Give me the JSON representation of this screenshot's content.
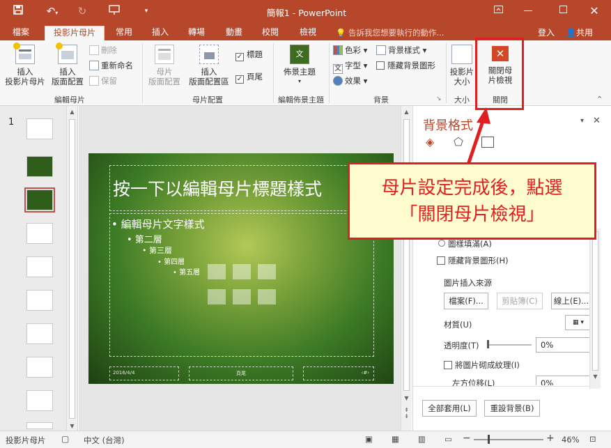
{
  "window": {
    "title": "簡報1 - PowerPoint",
    "controls": [
      "ribbon-display-icon",
      "minimize-icon",
      "restore-icon",
      "close-icon"
    ]
  },
  "quick_access": [
    "save-icon",
    "undo-icon",
    "redo-icon",
    "present-icon",
    "customize-icon"
  ],
  "tabs": [
    {
      "label": "檔案"
    },
    {
      "label": "投影片母片",
      "active": true
    },
    {
      "label": "常用"
    },
    {
      "label": "插入"
    },
    {
      "label": "轉場"
    },
    {
      "label": "動畫"
    },
    {
      "label": "校閱"
    },
    {
      "label": "檢視"
    }
  ],
  "tell_me": "告訴我您想要執行的動作...",
  "signin": "登入",
  "share": "共用",
  "ribbon": {
    "edit_master": {
      "label": "編輯母片",
      "insert_slide_master": "插入\n投影片母片",
      "insert_layout": "插入\n版面配置",
      "delete": "刪除",
      "rename": "重新命名",
      "preserve": "保留"
    },
    "master_layout": {
      "label": "母片配置",
      "master_layout_btn": "母片\n版面配置",
      "insert_placeholder": "插入\n版面配置區",
      "title_chk": "標題",
      "footer_chk": "頁尾"
    },
    "edit_theme": {
      "label": "編輯佈景主題",
      "themes": "佈景主題"
    },
    "background": {
      "label": "背景",
      "colors": "色彩",
      "fonts": "字型",
      "effects": "效果",
      "bg_styles": "背景樣式",
      "hide_bg": "隱藏背景圖形"
    },
    "size": {
      "label": "大小",
      "slide_size": "投影片\n大小"
    },
    "close": {
      "label": "關閉",
      "close_master": "關閉母\n片檢視"
    }
  },
  "thumbs": {
    "number": "1"
  },
  "slide": {
    "title": "按一下以編輯母片標題樣式",
    "level1": "• 編輯母片文字樣式",
    "level2": "• 第二層",
    "level3": "• 第三層",
    "level4": "• 第四層",
    "level5": "• 第五層",
    "date": "2016/4/4",
    "footer": "頁尾",
    "number": "‹#›"
  },
  "taskpane": {
    "title": "背景格式",
    "pattern_fill": "圖樣填滿(A)",
    "hide_bg_graphics": "隱藏背景圖形(H)",
    "insert_from": "圖片插入來源",
    "file_btn": "檔案(F)...",
    "clipboard_btn": "剪貼簿(C)",
    "online_btn": "線上(E)...",
    "texture": "材質(U)",
    "transparency": "透明度(T)",
    "transparency_value": "0%",
    "tile": "將圖片砌成紋理(I)",
    "offset_left": "左方位移(L)",
    "offset_left_value": "0%",
    "apply_all": "全部套用(L)",
    "reset_bg": "重設背景(B)"
  },
  "callout": {
    "line1": "母片設定完成後，點選",
    "line2": "「關閉母片檢視」"
  },
  "status": {
    "view": "投影片母片",
    "language": "中文 (台灣)",
    "zoom": "46%"
  },
  "colors": {
    "accent": "#b7472a",
    "callout_border": "#e02020",
    "callout_bg": "#fffdcf"
  }
}
